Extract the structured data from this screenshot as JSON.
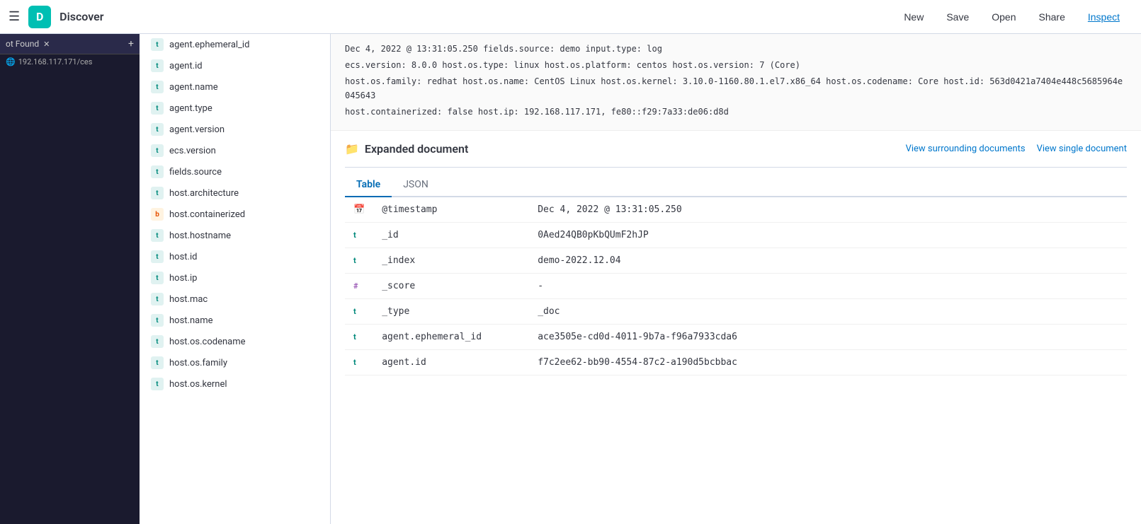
{
  "topbar": {
    "menu_icon": "☰",
    "logo_letter": "D",
    "app_title": "Discover",
    "new_label": "New",
    "save_label": "Save",
    "open_label": "Open",
    "share_label": "Share",
    "inspect_label": "Inspect"
  },
  "browser": {
    "tab_label": "ot Found",
    "url": "192.168.117.171/ces"
  },
  "sidebar": {
    "fields": [
      {
        "name": "agent.ephemeral_id",
        "type": "t",
        "type_class": "text"
      },
      {
        "name": "agent.id",
        "type": "t",
        "type_class": "text"
      },
      {
        "name": "agent.name",
        "type": "t",
        "type_class": "text"
      },
      {
        "name": "agent.type",
        "type": "t",
        "type_class": "text"
      },
      {
        "name": "agent.version",
        "type": "t",
        "type_class": "text"
      },
      {
        "name": "ecs.version",
        "type": "t",
        "type_class": "text"
      },
      {
        "name": "fields.source",
        "type": "t",
        "type_class": "text"
      },
      {
        "name": "host.architecture",
        "type": "t",
        "type_class": "text"
      },
      {
        "name": "host.containerized",
        "type": "b",
        "type_class": "bool"
      },
      {
        "name": "host.hostname",
        "type": "t",
        "type_class": "text"
      },
      {
        "name": "host.id",
        "type": "t",
        "type_class": "text"
      },
      {
        "name": "host.ip",
        "type": "t",
        "type_class": "text"
      },
      {
        "name": "host.mac",
        "type": "t",
        "type_class": "text"
      },
      {
        "name": "host.name",
        "type": "t",
        "type_class": "text"
      },
      {
        "name": "host.os.codename",
        "type": "t",
        "type_class": "text"
      },
      {
        "name": "host.os.family",
        "type": "t",
        "type_class": "text"
      },
      {
        "name": "host.os.kernel",
        "type": "t",
        "type_class": "text"
      }
    ]
  },
  "log_banner": {
    "line1": "Dec 4, 2022 @ 13:31:05.250  fields.source: demo  input.type: log",
    "line2": "ecs.version: 8.0.0  host.os.type: linux  host.os.platform: centos  host.os.version: 7 (Core)",
    "line3": "host.os.family: redhat  host.os.name: CentOS Linux  host.os.kernel: 3.10.0-1160.80.1.el7.x86_64  host.os.codename: Core  host.id: 563d0421a7404e448c5685964e045643",
    "line4": "host.containerized: false  host.ip: 192.168.117.171, fe80::f29:7a33:de06:d8d"
  },
  "expanded_doc": {
    "title": "Expanded document",
    "view_surrounding_label": "View surrounding documents",
    "view_single_label": "View single document",
    "tab_table": "Table",
    "tab_json": "JSON",
    "rows": [
      {
        "icon": "cal",
        "field": "@timestamp",
        "value": "Dec 4, 2022 @ 13:31:05.250"
      },
      {
        "icon": "t",
        "field": "_id",
        "value": "0Aed24QB0pKbQUmF2hJP"
      },
      {
        "icon": "t",
        "field": "_index",
        "value": "demo-2022.12.04"
      },
      {
        "icon": "#",
        "field": "_score",
        "value": "-"
      },
      {
        "icon": "t",
        "field": "_type",
        "value": "_doc"
      },
      {
        "icon": "t",
        "field": "agent.ephemeral_id",
        "value": "ace3505e-cd0d-4011-9b7a-f96a7933cda6"
      },
      {
        "icon": "t",
        "field": "agent.id",
        "value": "f7c2ee62-bb90-4554-87c2-a190d5bcbbac"
      }
    ]
  }
}
